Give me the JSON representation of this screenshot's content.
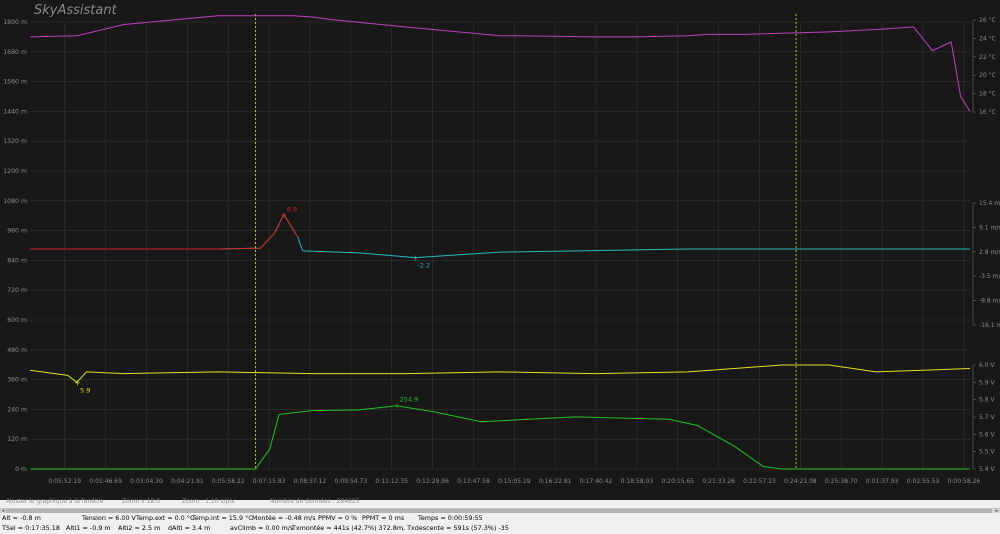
{
  "app": {
    "title": "SkyAssistant"
  },
  "colors": {
    "background": "#181818",
    "grid": "#333333",
    "axis_text": "#8c8c8c",
    "altitude": "#c040c0",
    "vario_up": "#d02828",
    "vario_down": "#28b8b8",
    "voltage": "#e0e020",
    "temperature": "#20c020",
    "marker": "#e8e840"
  },
  "status": {
    "fit": "Ajuster le graphique à la fenêtre",
    "zoom_x": "Zoom x 18.0",
    "zoom_s": "Zoom : 1.10 s/pix",
    "count": "Nombre de données : 284625"
  },
  "info": {
    "row1": [
      "Alt = -0.8 m",
      "Tension = 6.00 V",
      "Temp.ext = 0.0 °C",
      "Temp.int = 15.9 °C",
      "Montée = -0.48 m/s",
      "PPMV = 0 %",
      "PPMT = 0 ms",
      "Temps = 0:00:59:55"
    ],
    "row2": [
      "TSel = 0:17:35.18",
      "Alti1 = -0.9 m",
      "Alti2 = 2.5 m",
      "dAlti = 3.4 m",
      "avClimb = 0.00 m/s",
      "Txmontée = 441s (42.7%) 372.8m, Txdescente = 591s (57.3%) -35"
    ]
  },
  "chart_data": {
    "type": "line",
    "x_ticks": [
      "0:05:52.19",
      "0:01:46.69",
      "0:03:04.30",
      "0:04:21.91",
      "0:05:58.22",
      "0:07:15.83",
      "0:08:37.12",
      "0:09:54.73",
      "0:11:12.35",
      "0:12:29.96",
      "0:13:47.58",
      "0:15:05.19",
      "0:16:22.81",
      "0:17:40.42",
      "0:18:58.03",
      "0:20:15.65",
      "0:21:33.26",
      "0:22:57.23",
      "0:24:21.08",
      "0:25:38.70",
      "0:01:37.93",
      "0:02:55.53",
      "0:00:58.26"
    ],
    "y_left_ticks": [
      "1800 m",
      "1680 m",
      "1560 m",
      "1440 m",
      "1320 m",
      "1200 m",
      "1080 m",
      "960 m",
      "840 m",
      "720 m",
      "600 m",
      "480 m",
      "360 m",
      "240 m",
      "120 m",
      "0 m"
    ],
    "y_left_range": [
      0,
      1800
    ],
    "right_temp_ticks": [
      "26 °C",
      "24 °C",
      "22 °C",
      "20 °C",
      "18 °C",
      "16 °C"
    ],
    "right_vario_ticks": [
      "15.4 m/s",
      "9.1 m/s",
      "2.8 m/s",
      "-3.5 m/s",
      "-9.8 m/s",
      "-16.1 m/s"
    ],
    "right_voltage_ticks": [
      "6.0 V",
      "5.9 V",
      "5.8 V",
      "5.7 V",
      "5.6 V",
      "5.5 V",
      "5.4 V"
    ],
    "grid": true,
    "cursor_x": [
      "0:05:58.22",
      "0:24:21.08"
    ],
    "annotations": [
      {
        "label": "8.9",
        "series": "vario"
      },
      {
        "label": "-2.2",
        "series": "vario"
      },
      {
        "label": "5.9",
        "series": "voltage"
      },
      {
        "label": "254.9",
        "series": "altitude_green"
      }
    ],
    "series": [
      {
        "id": "altitude_purple",
        "axis": "left_m",
        "x": [
          0,
          5,
          10,
          20,
          28,
          30,
          32,
          40,
          50,
          52,
          60,
          64,
          70,
          72,
          76,
          80,
          85,
          90,
          94,
          96,
          98,
          99,
          100
        ],
        "y": [
          1740,
          1745,
          1790,
          1825,
          1825,
          1820,
          1810,
          1780,
          1745,
          1745,
          1740,
          1740,
          1745,
          1750,
          1750,
          1755,
          1760,
          1770,
          1780,
          1685,
          1720,
          1500,
          1440
        ]
      },
      {
        "id": "vario",
        "axis": "right_vario",
        "x": [
          0,
          10,
          20,
          24.5,
          26,
          27,
          28.5,
          29,
          35,
          41,
          50,
          60,
          65,
          70,
          80,
          90,
          100
        ],
        "y": [
          0,
          0,
          0,
          0.2,
          4,
          8.9,
          3,
          -0.5,
          -1.0,
          -2.2,
          -0.8,
          -0.4,
          -0.2,
          0,
          0,
          0,
          0
        ]
      },
      {
        "id": "voltage",
        "axis": "right_voltage",
        "x": [
          0,
          4,
          5,
          6,
          10,
          20,
          30,
          40,
          50,
          60,
          70,
          80,
          85,
          90,
          95,
          100
        ],
        "y": [
          5.97,
          5.94,
          5.9,
          5.96,
          5.95,
          5.96,
          5.95,
          5.95,
          5.96,
          5.95,
          5.96,
          6.0,
          6.0,
          5.96,
          5.97,
          5.98
        ]
      },
      {
        "id": "altitude_green",
        "axis": "left_m",
        "x": [
          0,
          24,
          25.5,
          26.5,
          30,
          35,
          39,
          43,
          48,
          53,
          58,
          63,
          68,
          71,
          75,
          78,
          80,
          85,
          90,
          95,
          100
        ],
        "y": [
          0,
          0,
          80,
          220,
          235,
          238,
          254.9,
          230,
          190,
          200,
          210,
          205,
          200,
          175,
          90,
          10,
          0,
          0,
          0,
          0,
          0
        ]
      }
    ]
  }
}
